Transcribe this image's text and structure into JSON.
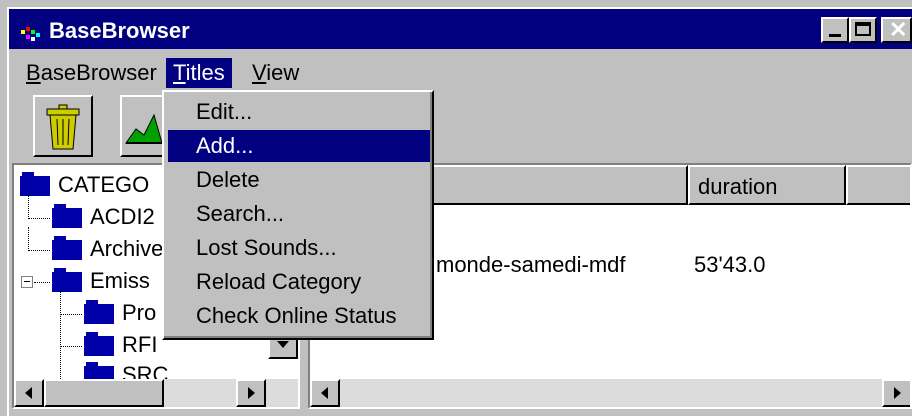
{
  "window": {
    "title": "BaseBrowser"
  },
  "menubar": {
    "items": [
      {
        "label": "BaseBrowser",
        "mnemonic": "B"
      },
      {
        "label": "Titles",
        "mnemonic": "T"
      },
      {
        "label": "View",
        "mnemonic": "V"
      }
    ]
  },
  "titles_menu": {
    "items": [
      {
        "label": "Edit..."
      },
      {
        "label": "Add..."
      },
      {
        "label": "Delete"
      },
      {
        "label": "Search..."
      },
      {
        "label": "Lost Sounds..."
      },
      {
        "label": "Reload Category"
      },
      {
        "label": "Check Online Status"
      }
    ],
    "highlighted_index": 1
  },
  "tree": {
    "items": [
      {
        "label": "CATEGO"
      },
      {
        "label": "ACDI2"
      },
      {
        "label": "Archive"
      },
      {
        "label": "Emiss"
      },
      {
        "label": "Pro"
      },
      {
        "label": "RFI"
      },
      {
        "label": "SRC"
      }
    ]
  },
  "list": {
    "columns": [
      {
        "label": "e"
      },
      {
        "label": "duration"
      },
      {
        "label": ""
      }
    ],
    "rows": [
      {
        "title": "monde-samedi-mdf",
        "duration": "53'43.0"
      }
    ]
  },
  "colors": {
    "title_bar": "#000080",
    "face": "#c0c0c0",
    "folder": "#0000a8"
  }
}
